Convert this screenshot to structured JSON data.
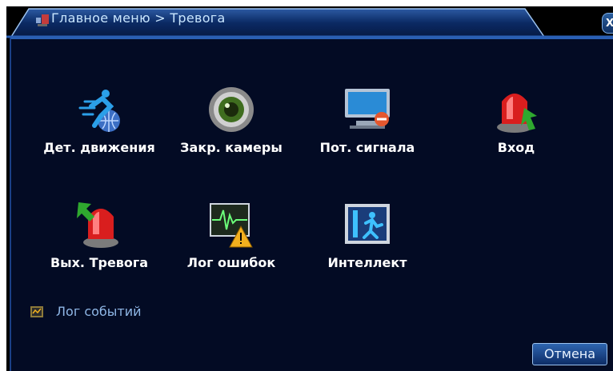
{
  "window": {
    "title": "Главное меню > Тревога",
    "close_label": "X"
  },
  "tiles": [
    {
      "label": "Дет. движения",
      "icon": "motion-detection-icon"
    },
    {
      "label": "Закр. камеры",
      "icon": "camera-blind-icon"
    },
    {
      "label": "Пот. сигнала",
      "icon": "video-loss-icon"
    },
    {
      "label": "Вход",
      "icon": "alarm-input-icon"
    },
    {
      "label": "Вых. Тревога",
      "icon": "alarm-output-icon"
    },
    {
      "label": "Лог ошибок",
      "icon": "error-log-icon"
    },
    {
      "label": "Интеллект",
      "icon": "intelligent-icon"
    }
  ],
  "event_log": {
    "label": "Лог событий",
    "icon": "event-log-icon"
  },
  "buttons": {
    "cancel": "Отмена"
  },
  "colors": {
    "background": "#030b24",
    "accent": "#2a5fb4",
    "label_text": "#ffffff",
    "link_text": "#8fb7e6"
  }
}
